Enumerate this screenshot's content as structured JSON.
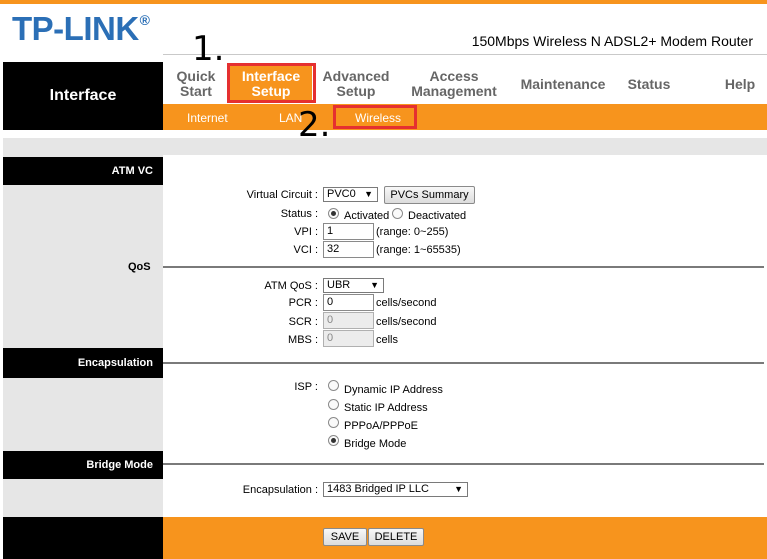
{
  "header": {
    "logo_text": "TP-LINK",
    "logo_mark": "®",
    "product_name": "150Mbps Wireless N ADSL2+ Modem Router",
    "section_title": "Interface"
  },
  "nav": {
    "quick_start": [
      "Quick",
      "Start"
    ],
    "interface_setup": [
      "Interface",
      "Setup"
    ],
    "advanced_setup": [
      "Advanced",
      "Setup"
    ],
    "access_management": [
      "Access",
      "Management"
    ],
    "maintenance": "Maintenance",
    "status": "Status",
    "help": "Help"
  },
  "subnav": {
    "internet": "Internet",
    "lan": "LAN",
    "wireless": "Wireless"
  },
  "annotations": {
    "step1": "1.",
    "step2": "2."
  },
  "sections": {
    "atm_vc": "ATM VC",
    "qos": "QoS",
    "encapsulation": "Encapsulation",
    "bridge_mode": "Bridge Mode"
  },
  "atm_vc": {
    "virtual_circuit_label": "Virtual Circuit :",
    "virtual_circuit_value": "PVC0",
    "pvcs_summary_label": "PVCs Summary",
    "status_label": "Status :",
    "status_activated": "Activated",
    "status_deactivated": "Deactivated",
    "vpi_label": "VPI :",
    "vpi_value": "1",
    "vpi_range": "(range: 0~255)",
    "vci_label": "VCI :",
    "vci_value": "32",
    "vci_range": "(range: 1~65535)"
  },
  "qos": {
    "atm_qos_label": "ATM QoS :",
    "atm_qos_value": "UBR",
    "pcr_label": "PCR :",
    "pcr_value": "0",
    "pcr_unit": "cells/second",
    "scr_label": "SCR :",
    "scr_value": "0",
    "scr_unit": "cells/second",
    "mbs_label": "MBS :",
    "mbs_value": "0",
    "mbs_unit": "cells"
  },
  "encapsulation": {
    "isp_label": "ISP :",
    "options": [
      "Dynamic IP Address",
      "Static IP Address",
      "PPPoA/PPPoE",
      "Bridge Mode"
    ],
    "selected": "Bridge Mode"
  },
  "bridge": {
    "encapsulation_label": "Encapsulation :",
    "encapsulation_value": "1483 Bridged IP LLC"
  },
  "footer": {
    "save_label": "SAVE",
    "delete_label": "DELETE"
  },
  "colors": {
    "brand_blue": "#2b6fb6",
    "accent_orange": "#f7941d",
    "highlight_red": "#e53030"
  }
}
